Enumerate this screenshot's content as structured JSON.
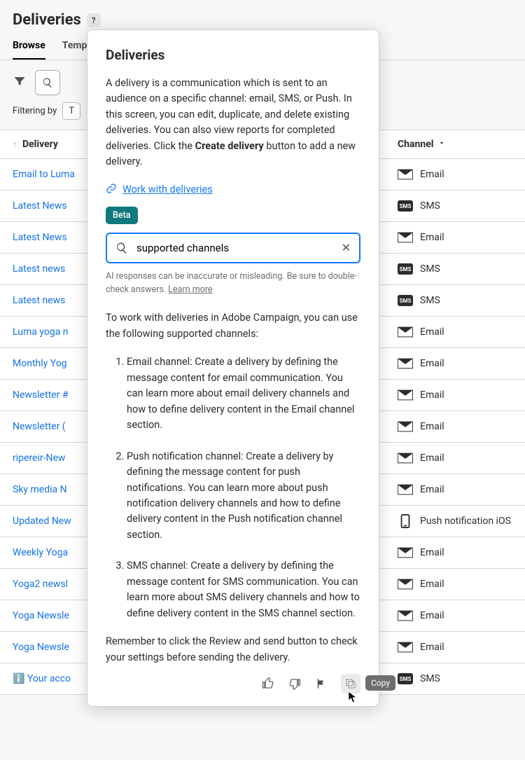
{
  "page": {
    "title": "Deliveries",
    "help_glyph": "?"
  },
  "tabs": [
    {
      "label": "Browse",
      "active": true
    },
    {
      "label": "Templates",
      "active": false
    }
  ],
  "filterbar": {
    "label": "Filtering by",
    "chip": "T"
  },
  "table": {
    "header": {
      "delivery": "Delivery",
      "channel": "Channel"
    },
    "rows": [
      {
        "name": "Email to Luma",
        "channel": "Email",
        "type": "email"
      },
      {
        "name": "Latest News",
        "channel": "SMS",
        "type": "sms"
      },
      {
        "name": "Latest News",
        "channel": "Email",
        "type": "email"
      },
      {
        "name": "Latest news",
        "channel": "SMS",
        "type": "sms"
      },
      {
        "name": "Latest news",
        "channel": "SMS",
        "type": "sms"
      },
      {
        "name": "Luma yoga n",
        "channel": "Email",
        "type": "email"
      },
      {
        "name": "Monthly Yog",
        "channel": "Email",
        "type": "email"
      },
      {
        "name": "Newsletter #",
        "channel": "Email",
        "type": "email"
      },
      {
        "name": "Newsletter (",
        "channel": "Email",
        "type": "email"
      },
      {
        "name": "ripereir-New",
        "channel": "Email",
        "type": "email"
      },
      {
        "name": "Sky media N",
        "channel": "Email",
        "type": "email"
      },
      {
        "name": "Updated New",
        "channel": "Push notification iOS",
        "type": "push"
      },
      {
        "name": "Weekly Yoga",
        "channel": "Email",
        "type": "email"
      },
      {
        "name": "Yoga2 newsl",
        "channel": "Email",
        "type": "email"
      },
      {
        "name": "Yoga Newsle",
        "channel": "Email",
        "type": "email"
      },
      {
        "name": "Yoga Newsle",
        "channel": "Email",
        "type": "email"
      },
      {
        "name": "ℹ️ Your acco",
        "channel": "SMS",
        "type": "sms"
      }
    ]
  },
  "popover": {
    "title": "Deliveries",
    "desc_pre": "A delivery is a communication which is sent to an audience on a specific channel: email, SMS, or Push. In this screen, you can edit, duplicate, and delete existing deliveries. You can also view reports for completed deliveries. Click the ",
    "desc_bold": "Create delivery",
    "desc_post": " button to add a new delivery.",
    "link_label": "Work with deliveries",
    "beta_label": "Beta",
    "search_value": "supported channels",
    "disclaimer_text": "AI responses can be inaccurate or misleading. Be sure to double-check answers. ",
    "disclaimer_learn": "Learn more",
    "response": {
      "intro": "To work with deliveries in Adobe Campaign, you can use the following supported channels:",
      "items": [
        "Email channel: Create a delivery by defining the message content for email communication. You can learn more about email delivery channels and how to define delivery content in the Email channel section.",
        "Push notification channel: Create a delivery by defining the message content for push notifications. You can learn more about push notification delivery channels and how to define delivery content in the Push notification channel section.",
        "SMS channel: Create a delivery by defining the message content for SMS communication. You can learn more about SMS delivery channels and how to define delivery content in the SMS channel section."
      ],
      "outro": "Remember to click the Review and send button to check your settings before sending the delivery."
    },
    "tooltip": "Copy"
  }
}
